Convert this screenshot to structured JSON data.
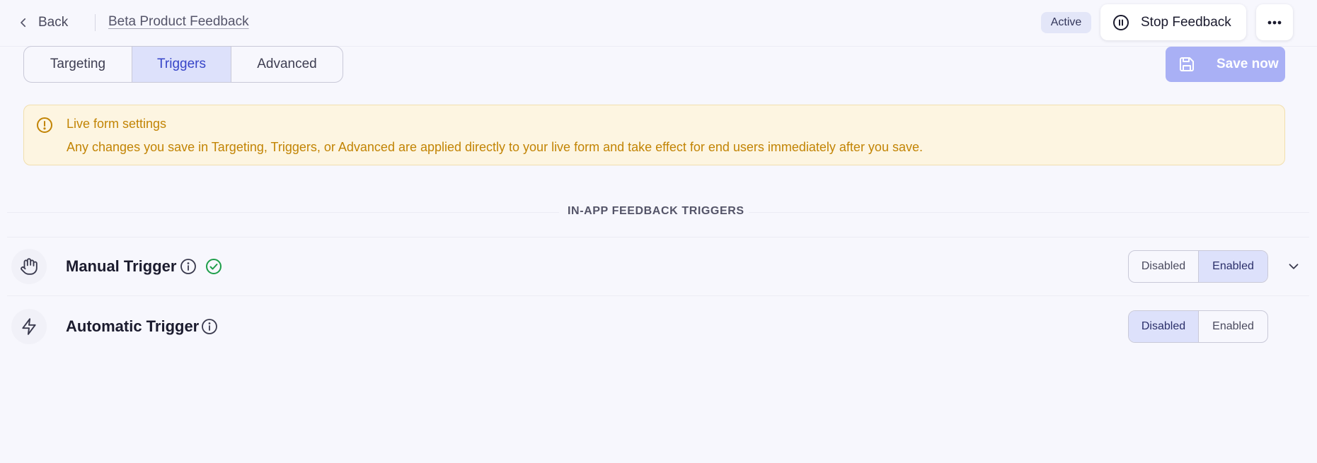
{
  "header": {
    "back_label": "Back",
    "breadcrumb": "Beta Product Feedback",
    "status_badge": "Active",
    "stop_label": "Stop Feedback"
  },
  "tabs": [
    {
      "label": "Targeting",
      "active": false
    },
    {
      "label": "Triggers",
      "active": true
    },
    {
      "label": "Advanced",
      "active": false
    }
  ],
  "save_label": "Save now",
  "alert": {
    "title": "Live form settings",
    "text": "Any changes you save in Targeting, Triggers, or Advanced are applied directly to your live form and take effect for end users immediately after you save."
  },
  "section_title": "IN-APP FEEDBACK TRIGGERS",
  "triggers": [
    {
      "title": "Manual Trigger",
      "icon": "hand-icon",
      "verified": true,
      "options": [
        "Disabled",
        "Enabled"
      ],
      "selected": "Enabled"
    },
    {
      "title": "Automatic Trigger",
      "icon": "lightning-icon",
      "verified": false,
      "options": [
        "Disabled",
        "Enabled"
      ],
      "selected": "Disabled"
    }
  ],
  "colors": {
    "accent": "#3745c8",
    "save_button": "#a9b0f5",
    "alert_text": "#c28404",
    "alert_bg": "#fdf5e1",
    "success": "#1e9e4a"
  }
}
